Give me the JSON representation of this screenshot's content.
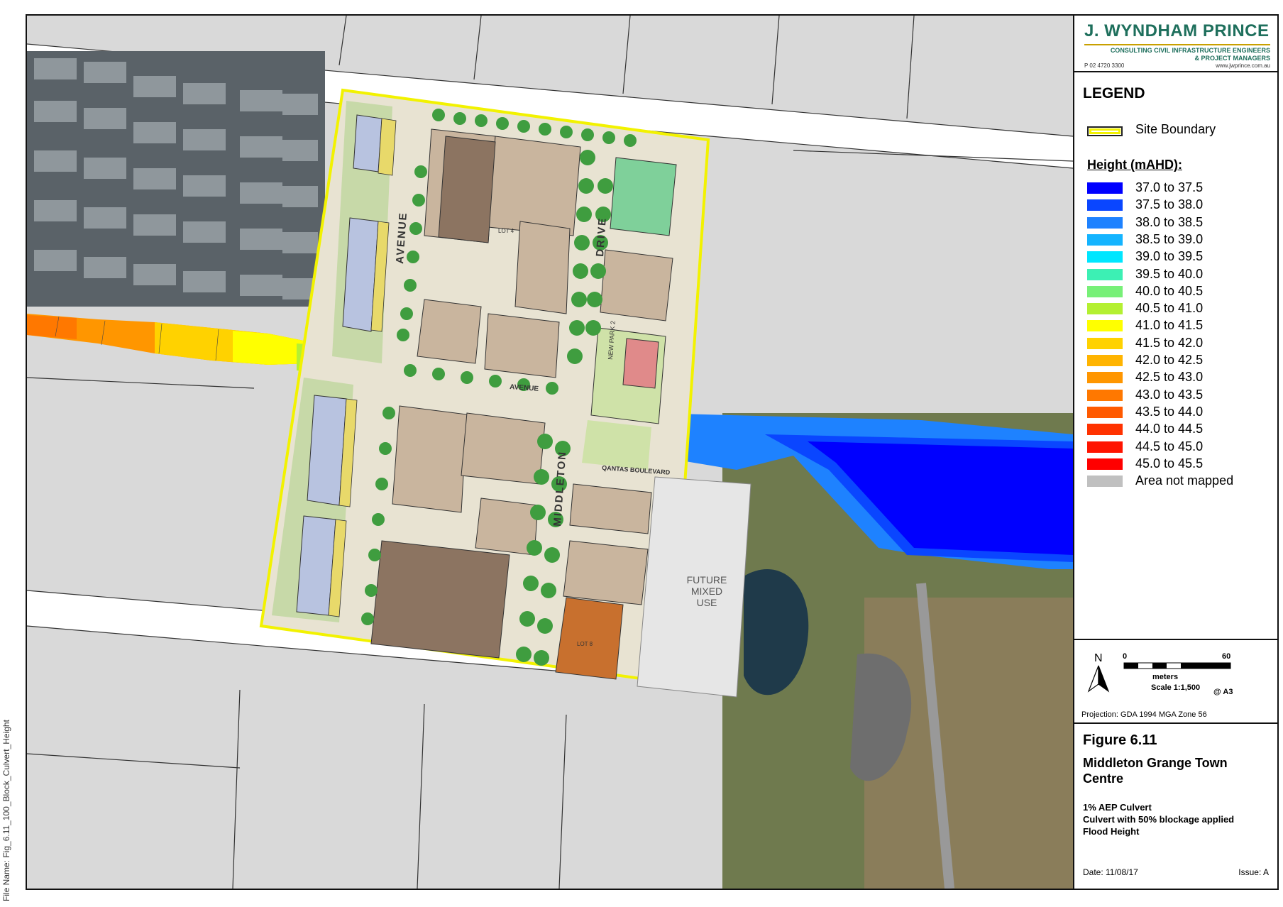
{
  "file_name": "File Name: Fig_6.11_100_Block_Culvert_Height",
  "logo": {
    "title": "J. WYNDHAM PRINCE",
    "subtitle_1": "CONSULTING CIVIL INFRASTRUCTURE ENGINEERS",
    "subtitle_2": "& PROJECT MANAGERS",
    "phone": "P 02 4720 3300",
    "website": "www.jwprince.com.au"
  },
  "legend": {
    "title": "LEGEND",
    "site_boundary_label": "Site Boundary",
    "height_title": "Height (mAHD):",
    "items": [
      {
        "label": "37.0 to 37.5",
        "color": "#0000ff"
      },
      {
        "label": "37.5 to 38.0",
        "color": "#0a46ff"
      },
      {
        "label": "38.0 to 38.5",
        "color": "#1e82ff"
      },
      {
        "label": "38.5 to 39.0",
        "color": "#14b4ff"
      },
      {
        "label": "39.0 to 39.5",
        "color": "#00e6ff"
      },
      {
        "label": "39.5 to 40.0",
        "color": "#3cf0b4"
      },
      {
        "label": "40.0 to 40.5",
        "color": "#78f078"
      },
      {
        "label": "40.5 to 41.0",
        "color": "#b4f032"
      },
      {
        "label": "41.0 to 41.5",
        "color": "#ffff00"
      },
      {
        "label": "41.5 to 42.0",
        "color": "#ffd200"
      },
      {
        "label": "42.0 to 42.5",
        "color": "#ffb400"
      },
      {
        "label": "42.5 to 43.0",
        "color": "#ff9600"
      },
      {
        "label": "43.0 to 43.5",
        "color": "#ff7800"
      },
      {
        "label": "43.5 to 44.0",
        "color": "#ff5a00"
      },
      {
        "label": "44.0 to 44.5",
        "color": "#ff3200"
      },
      {
        "label": "44.5 to 45.0",
        "color": "#ff1400"
      },
      {
        "label": "45.0 to 45.5",
        "color": "#ff0000"
      },
      {
        "label": "Area not mapped",
        "color": "#c0c0c0"
      }
    ]
  },
  "scale": {
    "north": "N",
    "tick_0": "0",
    "tick_60": "60",
    "units": "meters",
    "scale_text": "Scale 1:1,500",
    "paper": "@ A3",
    "projection": "Projection: GDA 1994 MGA Zone 56"
  },
  "figure": {
    "number": "Figure 6.11",
    "title": "Middleton Grange Town Centre",
    "line_1": "1% AEP Culvert",
    "line_2": "Culvert with 50% blockage applied",
    "line_3": "Flood Height",
    "date": "Date: 11/08/17",
    "issue": "Issue: A"
  },
  "map_labels": {
    "avenue_1": "AVENUE",
    "drive": "DRIVE",
    "middleton": "MIDDLETON",
    "avenue_2": "AVENUE",
    "qantas": "QANTAS BOULEVARD",
    "future_1": "FUTURE",
    "future_2": "MIXED",
    "future_3": "USE",
    "new_park": "NEW PARK 2",
    "lot_4": "LOT 4",
    "lot_8": "LOT 8"
  }
}
